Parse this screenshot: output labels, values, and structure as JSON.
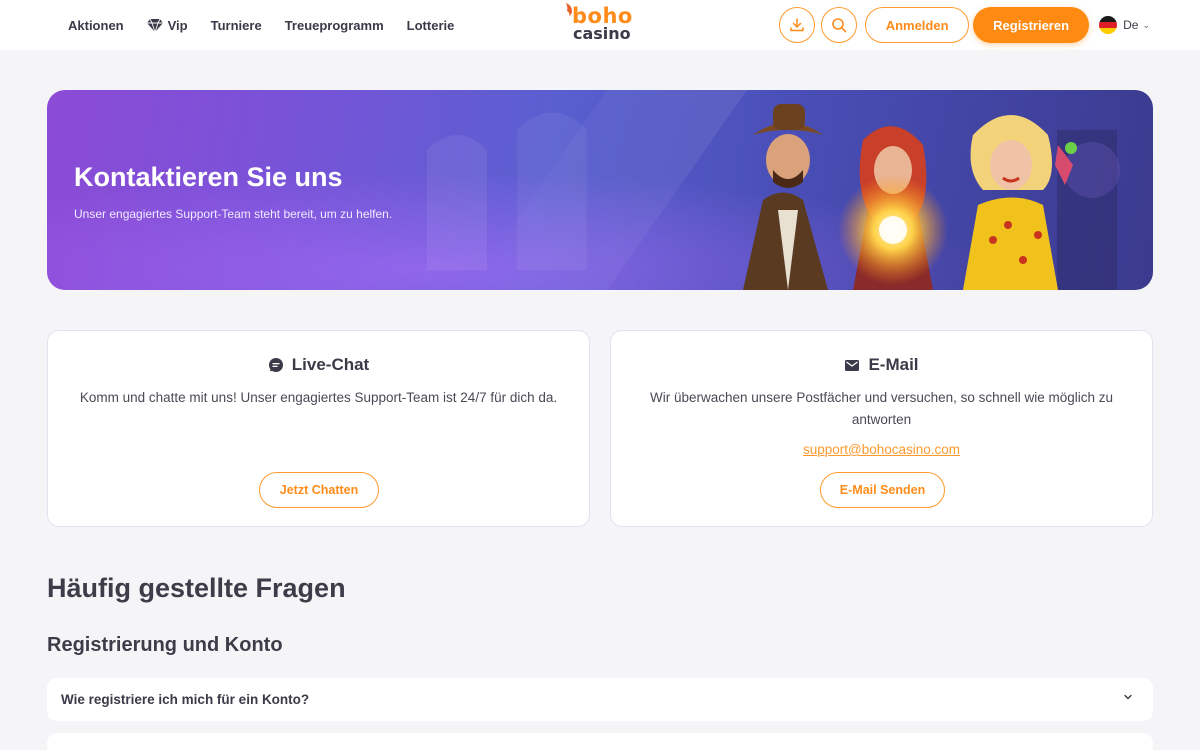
{
  "nav": {
    "items": [
      {
        "label": "Aktionen"
      },
      {
        "label": "Vip"
      },
      {
        "label": "Turniere"
      },
      {
        "label": "Treueprogramm"
      },
      {
        "label": "Lotterie"
      }
    ]
  },
  "logo": {
    "top": "boho",
    "bottom": "casino"
  },
  "header": {
    "login_label": "Anmelden",
    "register_label": "Registrieren",
    "language": "De"
  },
  "banner": {
    "title": "Kontaktieren Sie uns",
    "subtitle": "Unser engagiertes Support-Team steht bereit, um zu helfen."
  },
  "contact": {
    "chat": {
      "title": "Live-Chat",
      "text": "Komm und chatte mit uns! Unser engagiertes Support-Team ist 24/7 für dich da.",
      "button": "Jetzt Chatten"
    },
    "email": {
      "title": "E-Mail",
      "text": "Wir überwachen unsere Postfächer und versuchen, so schnell wie möglich zu antworten",
      "link": "support@bohocasino.com",
      "button": "E-Mail Senden"
    }
  },
  "faq": {
    "title": "Häufig gestellte Fragen",
    "section": "Registrierung und Konto",
    "questions": [
      {
        "label": "Wie registriere ich mich für ein Konto?"
      },
      {
        "label": ""
      }
    ]
  },
  "colors": {
    "accent": "#ff8a12",
    "text": "#3a3a48",
    "background": "#f5f5f7"
  },
  "icons": [
    "diamond-icon",
    "download-icon",
    "search-icon",
    "chat-bubble-icon",
    "envelope-icon",
    "chevron-down-icon",
    "german-flag-icon"
  ]
}
